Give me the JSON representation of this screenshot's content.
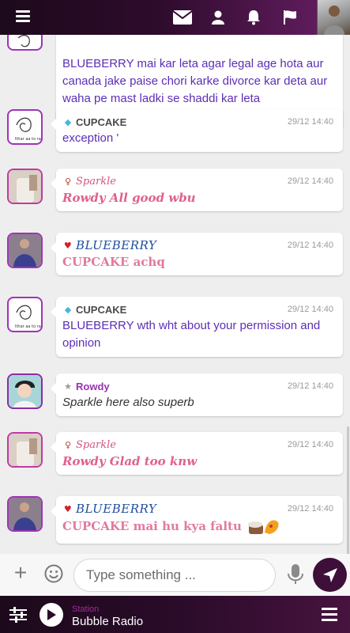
{
  "topbar": {
    "icons": [
      "menu-icon",
      "mail-icon",
      "user-icon",
      "bell-icon",
      "flag-icon",
      "profile-avatar"
    ],
    "accent": "#6a1f66"
  },
  "messages": [
    {
      "user": "",
      "rank_icon": "",
      "time": "",
      "text": "BLUEBERRY mai kar leta agar legal age hota aur canada jake paise chori karke divorce kar deta aur waha pe mast ladki se shaddi kar leta",
      "name_color": "#1f6fb2",
      "text_color": "#5b2fb5"
    },
    {
      "user": "CUPCAKE",
      "rank_icon": "diamond-icon",
      "time": "29/12 14:40",
      "text": "exception '",
      "name_color": "#4a4a4a",
      "text_color": "#5b2fb5"
    },
    {
      "user": "Sparkle",
      "rank_icon": "girl-icon",
      "time": "29/12 14:40",
      "text": "Rowdy All good wbu",
      "name_color": "#d4577c",
      "text_color": "#e0608e"
    },
    {
      "user": "BLUEBERRY",
      "rank_icon": "heart-icon",
      "time": "29/12 14:40",
      "text": "CUPCAKE achq",
      "name_color": "#1f4fa0",
      "text_color": "#e07aa0"
    },
    {
      "user": "CUPCAKE",
      "rank_icon": "diamond-icon",
      "time": "29/12 14:40",
      "text": "BLUEBERRY wth wht about your permission and opinion",
      "name_color": "#4a4a4a",
      "text_color": "#5b2fb5"
    },
    {
      "user": "Rowdy",
      "rank_icon": "star-icon",
      "time": "29/12 14:40",
      "text": "Sparkle here also superb",
      "name_color": "#9a33b0",
      "text_color": "#333333"
    },
    {
      "user": "Sparkle",
      "rank_icon": "girl-icon",
      "time": "29/12 14:40",
      "text": "Rowdy Glad too knw",
      "name_color": "#d4577c",
      "text_color": "#e0608e"
    },
    {
      "user": "BLUEBERRY",
      "rank_icon": "heart-icon",
      "time": "29/12 14:40",
      "text": "CUPCAKE mai hu kya faltu",
      "name_color": "#1f4fa0",
      "text_color": "#e07aa0"
    }
  ],
  "input": {
    "placeholder": "Type something ..."
  },
  "player": {
    "station_label": "Station",
    "station_name": "Bubble Radio"
  }
}
